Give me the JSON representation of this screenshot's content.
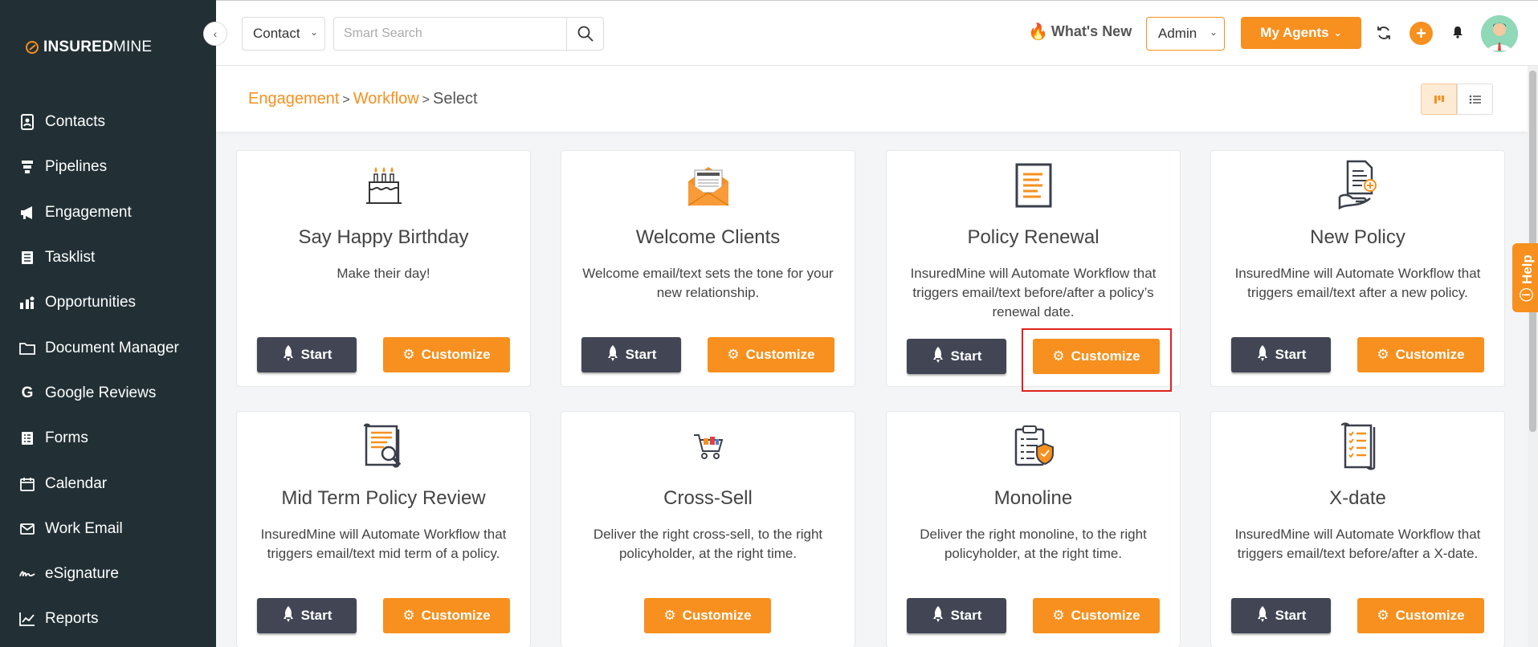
{
  "sidebar": {
    "logo_bold": "INSURED",
    "logo_light": "MINE",
    "items": [
      {
        "label": "Contacts",
        "icon": "contacts-icon"
      },
      {
        "label": "Pipelines",
        "icon": "pipelines-icon"
      },
      {
        "label": "Engagement",
        "icon": "megaphone-icon"
      },
      {
        "label": "Tasklist",
        "icon": "tasklist-icon"
      },
      {
        "label": "Opportunities",
        "icon": "opportunities-icon"
      },
      {
        "label": "Document Manager",
        "icon": "folder-icon"
      },
      {
        "label": "Google Reviews",
        "icon": "google-icon"
      },
      {
        "label": "Forms",
        "icon": "forms-icon"
      },
      {
        "label": "Calendar",
        "icon": "calendar-icon"
      },
      {
        "label": "Work Email",
        "icon": "email-icon"
      },
      {
        "label": "eSignature",
        "icon": "signature-icon"
      },
      {
        "label": "Reports",
        "icon": "reports-icon"
      }
    ]
  },
  "topbar": {
    "contact_select": "Contact",
    "search_placeholder": "Smart Search",
    "whats_new": "What's New",
    "admin_select": "Admin",
    "my_agents": "My Agents"
  },
  "breadcrumb": {
    "items": [
      "Engagement",
      "Workflow",
      "Select"
    ]
  },
  "help_label": "Help",
  "cards": [
    {
      "title": "Say Happy Birthday",
      "desc": "Make their day!",
      "start": "Start",
      "customize": "Customize",
      "icon": "birthday-cake-icon"
    },
    {
      "title": "Welcome Clients",
      "desc": "Welcome email/text sets the tone for your new relationship.",
      "start": "Start",
      "customize": "Customize",
      "icon": "welcome-envelope-icon"
    },
    {
      "title": "Policy Renewal",
      "desc": "InsuredMine will Automate Workflow that triggers email/text before/after a policy’s renewal date.",
      "start": "Start",
      "customize": "Customize",
      "icon": "policy-document-icon"
    },
    {
      "title": "New Policy",
      "desc": "InsuredMine will Automate Workflow that triggers email/text after a new policy.",
      "start": "Start",
      "customize": "Customize",
      "icon": "new-policy-icon"
    },
    {
      "title": "Mid Term Policy Review",
      "desc": "InsuredMine will Automate Workflow that triggers email/text mid term of a policy.",
      "start": "Start",
      "customize": "Customize",
      "icon": "policy-review-icon"
    },
    {
      "title": "Cross-Sell",
      "desc": "Deliver the right cross-sell, to the right policyholder, at the right time.",
      "start": "",
      "customize": "Customize",
      "icon": "shopping-cart-icon"
    },
    {
      "title": "Monoline",
      "desc": "Deliver the right monoline, to the right policyholder, at the right time.",
      "start": "Start",
      "customize": "Customize",
      "icon": "clipboard-shield-icon"
    },
    {
      "title": "X-date",
      "desc": "InsuredMine will Automate Workflow that triggers email/text before/after a X-date.",
      "start": "Start",
      "customize": "Customize",
      "icon": "checklist-scroll-icon"
    }
  ]
}
